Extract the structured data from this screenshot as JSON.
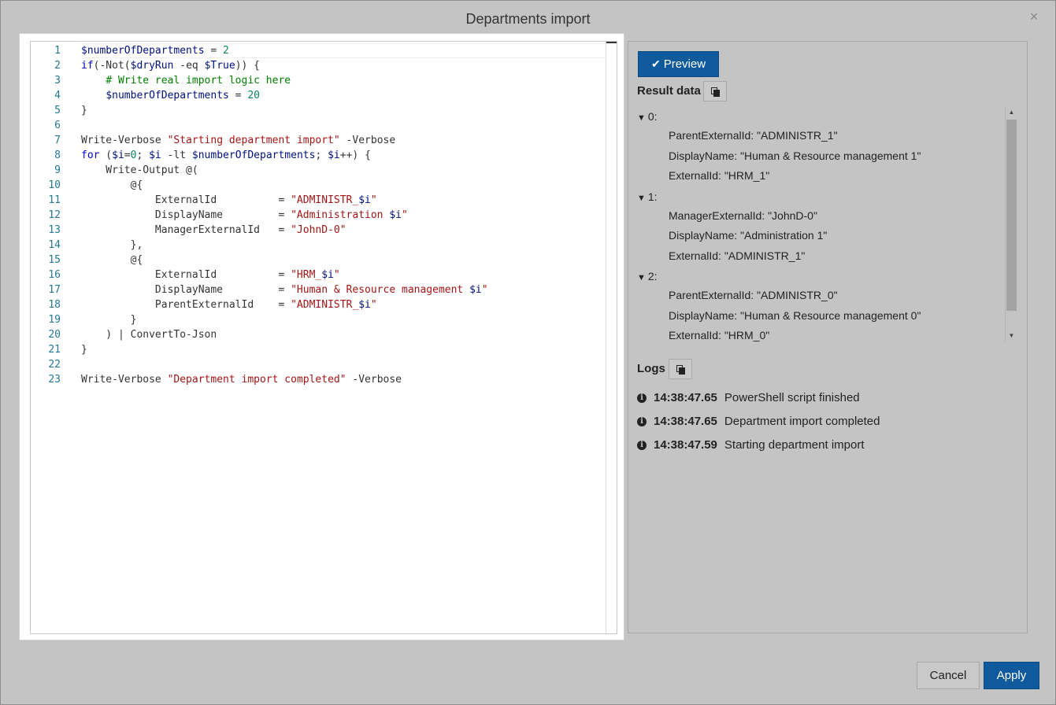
{
  "dialog": {
    "title": "Departments import",
    "close_glyph": "×"
  },
  "editor": {
    "lines": [
      [
        {
          "t": "var",
          "v": "$numberOfDepartments"
        },
        {
          "t": "op",
          "v": " = "
        },
        {
          "t": "num",
          "v": "2"
        }
      ],
      [
        {
          "t": "kw",
          "v": "if"
        },
        {
          "t": "op",
          "v": "(-Not("
        },
        {
          "t": "var",
          "v": "$dryRun"
        },
        {
          "t": "op",
          "v": " -eq "
        },
        {
          "t": "var",
          "v": "$True"
        },
        {
          "t": "op",
          "v": ")) {"
        }
      ],
      [
        {
          "t": "op",
          "v": "    "
        },
        {
          "t": "cm",
          "v": "# Write real import logic here"
        }
      ],
      [
        {
          "t": "op",
          "v": "    "
        },
        {
          "t": "var",
          "v": "$numberOfDepartments"
        },
        {
          "t": "op",
          "v": " = "
        },
        {
          "t": "num",
          "v": "20"
        }
      ],
      [
        {
          "t": "op",
          "v": "}"
        }
      ],
      [],
      [
        {
          "t": "op",
          "v": "Write-Verbose "
        },
        {
          "t": "str",
          "v": "\"Starting department import\""
        },
        {
          "t": "op",
          "v": " -Verbose"
        }
      ],
      [
        {
          "t": "kw",
          "v": "for"
        },
        {
          "t": "op",
          "v": " ("
        },
        {
          "t": "var",
          "v": "$i"
        },
        {
          "t": "op",
          "v": "="
        },
        {
          "t": "num",
          "v": "0"
        },
        {
          "t": "op",
          "v": "; "
        },
        {
          "t": "var",
          "v": "$i"
        },
        {
          "t": "op",
          "v": " -lt "
        },
        {
          "t": "var",
          "v": "$numberOfDepartments"
        },
        {
          "t": "op",
          "v": "; "
        },
        {
          "t": "var",
          "v": "$i"
        },
        {
          "t": "op",
          "v": "++) {"
        }
      ],
      [
        {
          "t": "op",
          "v": "    Write-Output @("
        }
      ],
      [
        {
          "t": "op",
          "v": "        @{"
        }
      ],
      [
        {
          "t": "op",
          "v": "            ExternalId          = "
        },
        {
          "t": "str",
          "v": "\"ADMINISTR_"
        },
        {
          "t": "var",
          "v": "$i"
        },
        {
          "t": "str",
          "v": "\""
        }
      ],
      [
        {
          "t": "op",
          "v": "            DisplayName         = "
        },
        {
          "t": "str",
          "v": "\"Administration "
        },
        {
          "t": "var",
          "v": "$i"
        },
        {
          "t": "str",
          "v": "\""
        }
      ],
      [
        {
          "t": "op",
          "v": "            ManagerExternalId   = "
        },
        {
          "t": "str",
          "v": "\"JohnD-0\""
        }
      ],
      [
        {
          "t": "op",
          "v": "        },"
        }
      ],
      [
        {
          "t": "op",
          "v": "        @{"
        }
      ],
      [
        {
          "t": "op",
          "v": "            ExternalId          = "
        },
        {
          "t": "str",
          "v": "\"HRM_"
        },
        {
          "t": "var",
          "v": "$i"
        },
        {
          "t": "str",
          "v": "\""
        }
      ],
      [
        {
          "t": "op",
          "v": "            DisplayName         = "
        },
        {
          "t": "str",
          "v": "\"Human & Resource management "
        },
        {
          "t": "var",
          "v": "$i"
        },
        {
          "t": "str",
          "v": "\""
        }
      ],
      [
        {
          "t": "op",
          "v": "            ParentExternalId    = "
        },
        {
          "t": "str",
          "v": "\"ADMINISTR_"
        },
        {
          "t": "var",
          "v": "$i"
        },
        {
          "t": "str",
          "v": "\""
        }
      ],
      [
        {
          "t": "op",
          "v": "        }"
        }
      ],
      [
        {
          "t": "op",
          "v": "    ) | ConvertTo-Json"
        }
      ],
      [
        {
          "t": "op",
          "v": "}"
        }
      ],
      [],
      [
        {
          "t": "op",
          "v": "Write-Verbose "
        },
        {
          "t": "str",
          "v": "\"Department import completed\""
        },
        {
          "t": "op",
          "v": " -Verbose"
        }
      ]
    ]
  },
  "panel": {
    "preview_label": "Preview",
    "preview_check": "✔",
    "result_title": "Result data",
    "logs_title": "Logs",
    "result_groups": [
      {
        "key": "0:",
        "entries": [
          {
            "k": "ParentExternalId:",
            "v": "\"ADMINISTR_1\""
          },
          {
            "k": "DisplayName:",
            "v": "\"Human & Resource management 1\""
          },
          {
            "k": "ExternalId:",
            "v": "\"HRM_1\""
          }
        ]
      },
      {
        "key": "1:",
        "entries": [
          {
            "k": "ManagerExternalId:",
            "v": "\"JohnD-0\""
          },
          {
            "k": "DisplayName:",
            "v": "\"Administration 1\""
          },
          {
            "k": "ExternalId:",
            "v": "\"ADMINISTR_1\""
          }
        ]
      },
      {
        "key": "2:",
        "entries": [
          {
            "k": "ParentExternalId:",
            "v": "\"ADMINISTR_0\""
          },
          {
            "k": "DisplayName:",
            "v": "\"Human & Resource management 0\""
          },
          {
            "k": "ExternalId:",
            "v": "\"HRM_0\""
          }
        ]
      }
    ],
    "logs": [
      {
        "time": "14:38:47.65",
        "msg": "PowerShell script finished"
      },
      {
        "time": "14:38:47.65",
        "msg": "Department import completed"
      },
      {
        "time": "14:38:47.59",
        "msg": "Starting department import"
      }
    ]
  },
  "footer": {
    "cancel_label": "Cancel",
    "apply_label": "Apply"
  },
  "colors": {
    "primary": "#0e5a9c",
    "background": "#c4c4c4"
  }
}
